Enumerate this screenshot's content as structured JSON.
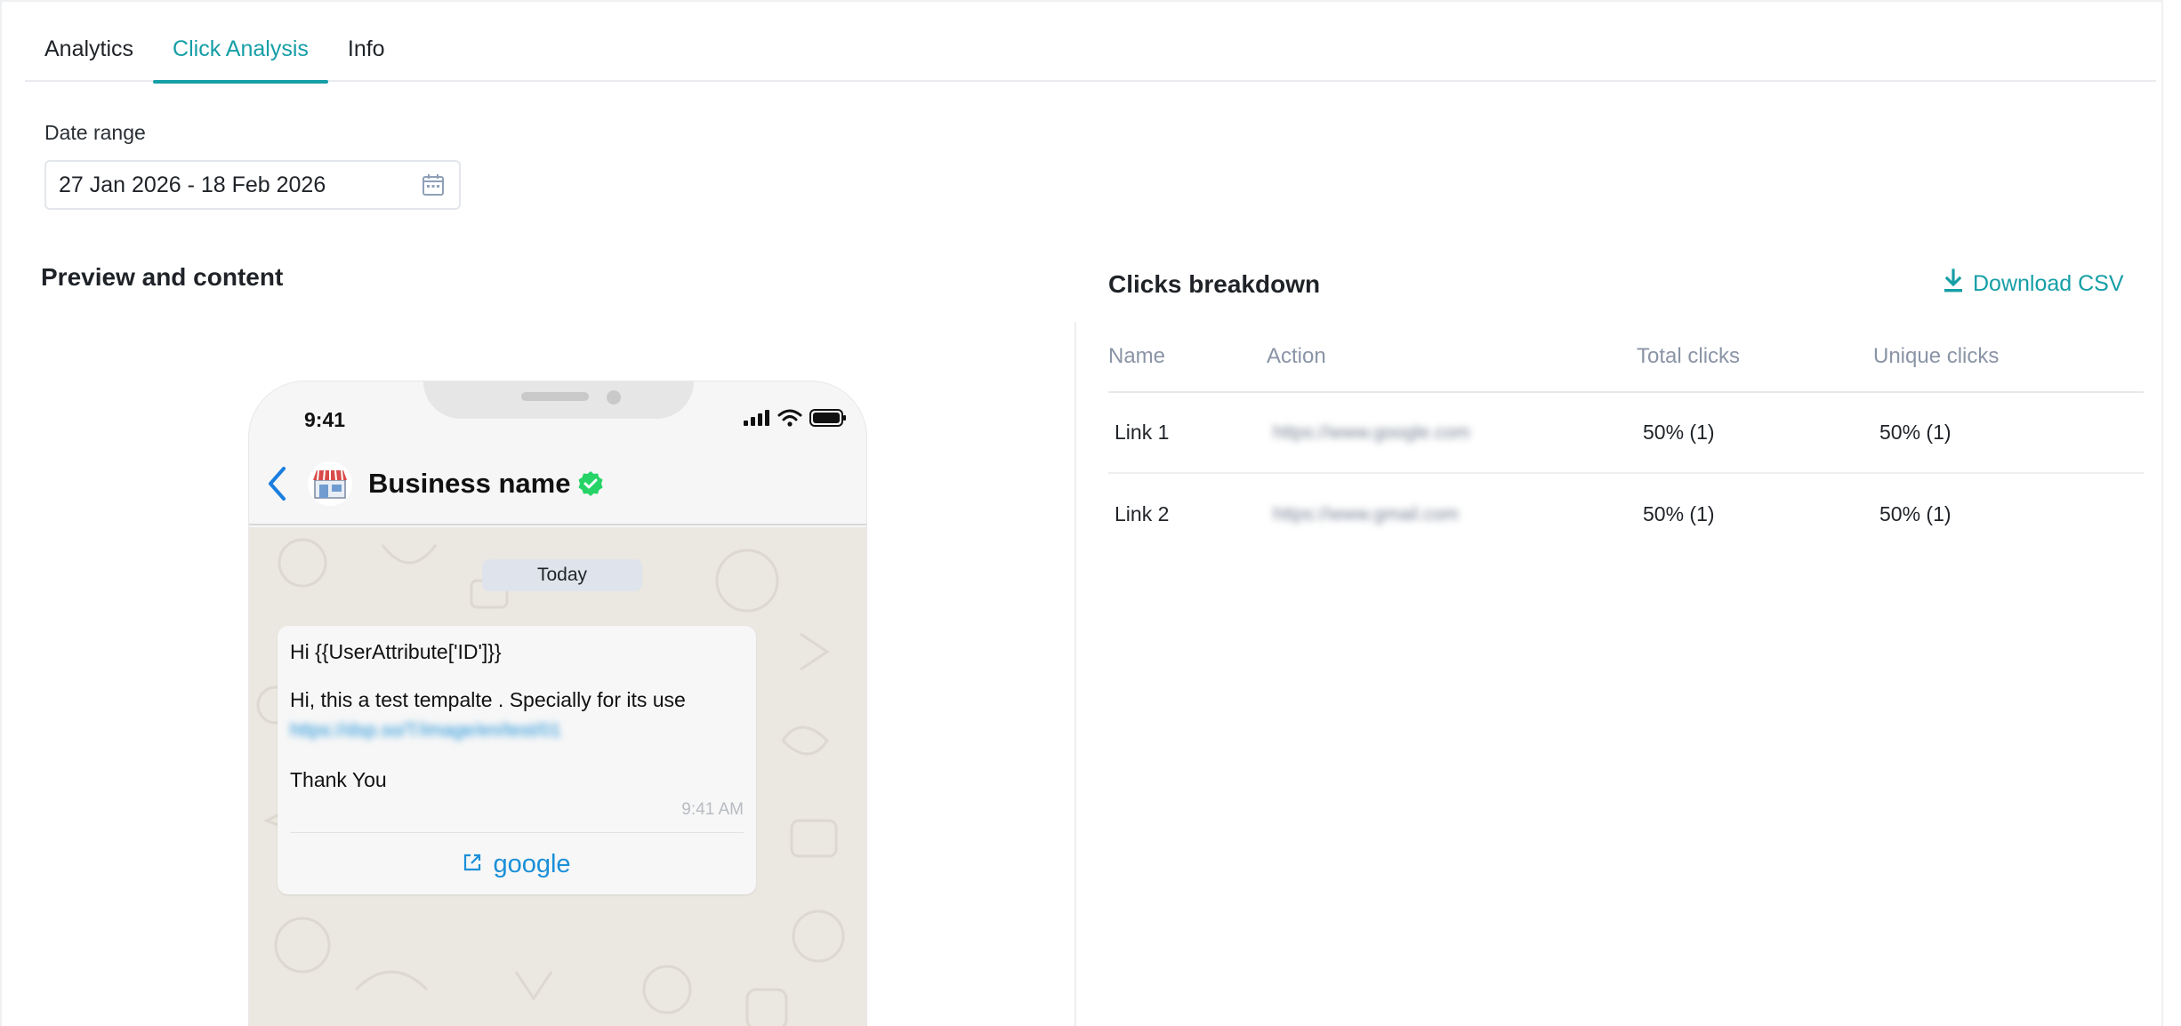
{
  "tabs": [
    {
      "label": "Analytics",
      "active": false
    },
    {
      "label": "Click Analysis",
      "active": true
    },
    {
      "label": "Info",
      "active": false
    }
  ],
  "date_range": {
    "label": "Date range",
    "value": "27 Jan 2026 - 18 Feb 2026",
    "icon": "calendar-icon"
  },
  "preview": {
    "heading": "Preview and content",
    "phone": {
      "time": "9:41",
      "business_name": "Business name",
      "date_chip": "Today",
      "message": {
        "greeting": "Hi {{UserAttribute['ID']}}",
        "body": "Hi, this a test tempalte . Specially for its use",
        "link": "https://dsp.so/T/image/en/test/01",
        "closing": "Thank You",
        "time": "9:41 AM",
        "cta_label": "google",
        "cta_icon": "external-link-icon"
      }
    }
  },
  "clicks": {
    "heading": "Clicks breakdown",
    "download_label": "Download CSV",
    "columns": [
      "Name",
      "Action",
      "Total clicks",
      "Unique clicks"
    ],
    "rows": [
      {
        "name": "Link 1",
        "action": "https://www.google.com",
        "total": "50% (1)",
        "unique": "50% (1)"
      },
      {
        "name": "Link 2",
        "action": "https://www.gmail.com",
        "total": "50% (1)",
        "unique": "50% (1)"
      }
    ]
  },
  "colors": {
    "accent": "#159ea6",
    "link": "#1a8fd8",
    "verified": "#25d366",
    "header_text": "#8a94a6"
  }
}
